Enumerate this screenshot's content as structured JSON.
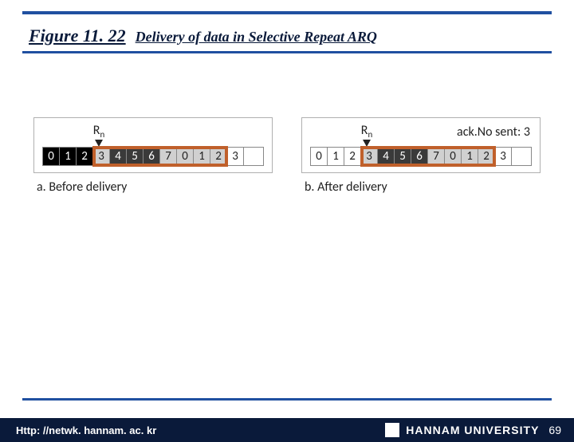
{
  "figure": {
    "number": "Figure 11. 22",
    "caption": "Delivery of data in Selective Repeat ARQ"
  },
  "panels": {
    "before": {
      "rn_label": "R",
      "rn_sub": "n",
      "cells": [
        "0",
        "1",
        "2",
        "3",
        "4",
        "5",
        "6",
        "7",
        "0",
        "1",
        "2",
        "3"
      ],
      "caption": "a. Before delivery"
    },
    "after": {
      "rn_label": "R",
      "rn_sub": "n",
      "ack_label": "ack.No sent: 3",
      "cells": [
        "0",
        "1",
        "2",
        "3",
        "4",
        "5",
        "6",
        "7",
        "0",
        "1",
        "2",
        "3"
      ],
      "caption": "b. After delivery"
    }
  },
  "footer": {
    "url": "Http: //netwk. hannam. ac. kr",
    "university": "HANNAM  UNIVERSITY",
    "page": "69"
  },
  "chart_data": [
    {
      "type": "table",
      "title": "a. Before delivery",
      "sequence": [
        0,
        1,
        2,
        3,
        4,
        5,
        6,
        7,
        0,
        1,
        2,
        3
      ],
      "Rn_index": 3,
      "received_black": [
        0,
        1,
        2
      ],
      "received_dark": [
        4,
        5,
        6
      ],
      "window_start": 3,
      "window_end": 10
    },
    {
      "type": "table",
      "title": "b. After delivery",
      "ack_no_sent": 3,
      "sequence": [
        0,
        1,
        2,
        3,
        4,
        5,
        6,
        7,
        0,
        1,
        2,
        3
      ],
      "Rn_index": 3,
      "received_dark": [
        4,
        5,
        6
      ],
      "window_start": 3,
      "window_end": 10
    }
  ]
}
